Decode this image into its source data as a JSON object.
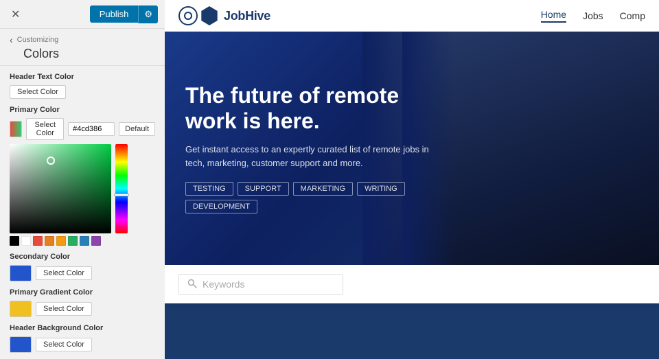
{
  "topbar": {
    "close_label": "✕",
    "publish_label": "Publish",
    "gear_label": "⚙"
  },
  "breadcrumb": {
    "back_label": "‹",
    "sub_label": "Customizing",
    "title_label": "Colors"
  },
  "panel": {
    "header_text_color_label": "Header Text Color",
    "header_text_select_label": "Select Color",
    "primary_color_label": "Primary Color",
    "primary_select_label": "Select Color",
    "primary_hex_value": "#4cd386",
    "primary_default_label": "Default",
    "secondary_color_label": "Secondary Color",
    "secondary_select_label": "Select Color",
    "primary_gradient_label": "Primary Gradient Color",
    "primary_gradient_select": "Select Color",
    "header_bg_label": "Header Background Color",
    "header_bg_select": "Select Color"
  },
  "swatches": [
    "#000000",
    "#ffffff",
    "#e74c3c",
    "#e67e22",
    "#f39c12",
    "#27ae60",
    "#2980b9",
    "#8e44ad"
  ],
  "nav": {
    "brand": "JobHive",
    "home": "Home",
    "jobs": "Jobs",
    "comp": "Comp"
  },
  "hero": {
    "title": "The future of remote work is here.",
    "subtitle": "Get instant access to an expertly curated list of remote jobs in tech, marketing, customer support and more.",
    "tags": [
      "TESTING",
      "SUPPORT",
      "MARKETING",
      "WRITING",
      "DEVELOPMENT"
    ]
  },
  "search": {
    "placeholder": "Keywords"
  }
}
